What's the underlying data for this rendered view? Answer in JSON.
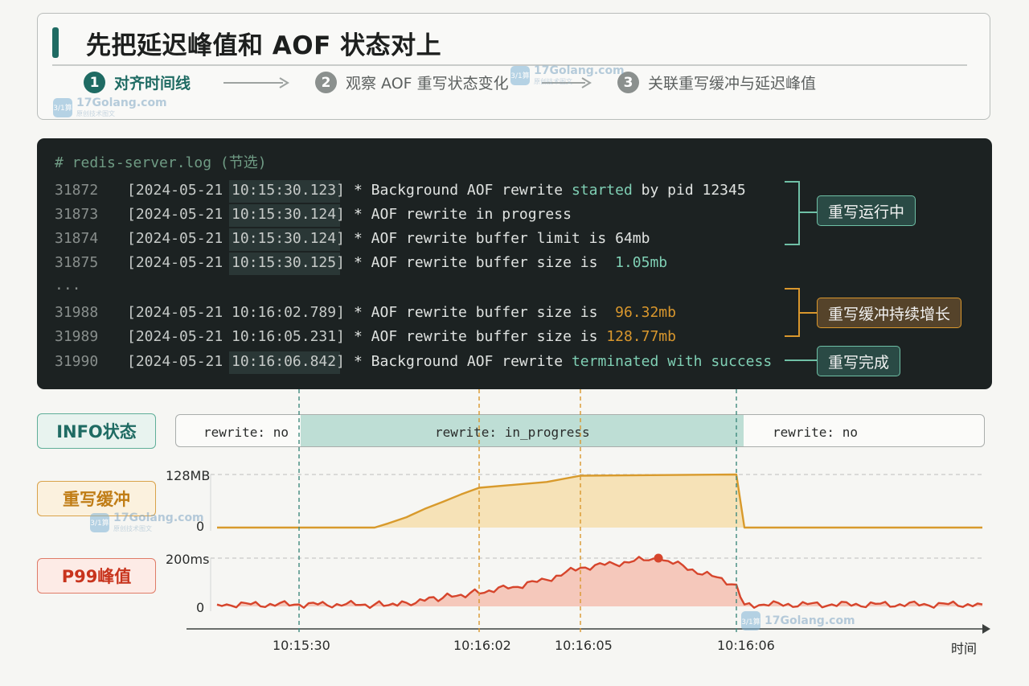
{
  "colors": {
    "teal": "#1f6b63",
    "teal_text": "#7fcfb4",
    "teal_box_bg": "#2a4a45",
    "teal_box_border": "#6fc0a6",
    "amber": "#d9972d",
    "amber_box_bg": "#55432a",
    "red": "#d6452c",
    "info_fill": "#a9d4c8",
    "buffer_line": "#d89a2c",
    "buffer_fill": "#f6dba3",
    "p99_line": "#d6452c",
    "p99_fill": "#f4b8a8"
  },
  "header": {
    "title": "先把延迟峰值和 AOF 状态对上",
    "steps": [
      {
        "num": "1",
        "label": "对齐时间线",
        "active": true
      },
      {
        "num": "2",
        "label": "观察 AOF 重写状态变化",
        "active": false
      },
      {
        "num": "3",
        "label": "关联重写缓冲与延迟峰值",
        "active": false
      }
    ]
  },
  "log": {
    "comment": "#  redis-server.log (节选)",
    "ellipsis": "...",
    "lines": [
      {
        "no": "31872",
        "ts": "[2024-05-21 10:15:30.123]",
        "pre": "* Background AOF rewrite ",
        "hl": "started",
        "post": " by pid 12345",
        "hl_color": "teal"
      },
      {
        "no": "31873",
        "ts": "[2024-05-21 10:15:30.124]",
        "pre": "* AOF rewrite in progress",
        "hl": "",
        "post": "",
        "hl_color": "teal"
      },
      {
        "no": "31874",
        "ts": "[2024-05-21 10:15:30.124]",
        "pre": "* AOF rewrite buffer limit is 64mb",
        "hl": "",
        "post": "",
        "hl_color": "teal"
      },
      {
        "no": "31875",
        "ts": "[2024-05-21 10:15:30.125]",
        "pre": "* AOF rewrite buffer size is  ",
        "hl": "1.05mb",
        "post": "",
        "hl_color": "teal"
      },
      {
        "no": "31988",
        "ts": "[2024-05-21 10:16:02.789]",
        "pre": "* AOF rewrite buffer size is  ",
        "hl": "96.32mb",
        "post": "",
        "hl_color": "amber"
      },
      {
        "no": "31989",
        "ts": "[2024-05-21 10:16:05.231]",
        "pre": "* AOF rewrite buffer size is ",
        "hl": "128.77mb",
        "post": "",
        "hl_color": "amber"
      },
      {
        "no": "31990",
        "ts": "[2024-05-21 10:16:06.842]",
        "pre": "* Background AOF rewrite ",
        "hl": "terminated with success",
        "post": "",
        "hl_color": "teal"
      }
    ],
    "annotations": {
      "running": "重写运行中",
      "growing": "重写缓冲持续增长",
      "done": "重写完成"
    }
  },
  "rows": {
    "info_label": "INFO状态",
    "buffer_label": "重写缓冲",
    "p99_label": "P99峰值",
    "info_states": [
      "rewrite: no",
      "rewrite: in_progress",
      "rewrite: no"
    ]
  },
  "watermark": {
    "text": "17Golang.com",
    "sub": "原创技术图文",
    "logo": "3/1算"
  },
  "chart_data": {
    "type": "line",
    "x_axis_title": "时间",
    "x_ticks": [
      "10:15:30",
      "10:16:02",
      "10:16:05",
      "10:16:06"
    ],
    "series": [
      {
        "name": "重写缓冲",
        "unit": "MB",
        "y_ticks": [
          "128MB",
          "0"
        ],
        "ylim": [
          0,
          128
        ],
        "x": [
          "10:15:21",
          "10:15:39",
          "10:15:42",
          "10:15:46",
          "10:15:50",
          "10:15:54",
          "10:15:58",
          "10:16:02",
          "10:16:04",
          "10:16:05",
          "10:16:06",
          "10:16:06.3",
          "10:16:11"
        ],
        "y": [
          0,
          0,
          10,
          25,
          45,
          62,
          80,
          96,
          110,
          125,
          128,
          0,
          0
        ]
      },
      {
        "name": "P99峰值",
        "unit": "ms",
        "y_ticks": [
          "200ms",
          "0"
        ],
        "ylim": [
          0,
          200
        ],
        "peak": {
          "x": "10:16:05.5",
          "y": 200
        },
        "x": [
          "10:15:21",
          "10:15:30",
          "10:15:39",
          "10:15:46",
          "10:15:54",
          "10:16:00",
          "10:16:03",
          "10:16:04",
          "10:16:05",
          "10:16:05.5",
          "10:16:06",
          "10:16:06.3",
          "10:16:11"
        ],
        "y": [
          8,
          8,
          8,
          15,
          35,
          55,
          80,
          110,
          160,
          200,
          90,
          8,
          8
        ]
      }
    ]
  }
}
